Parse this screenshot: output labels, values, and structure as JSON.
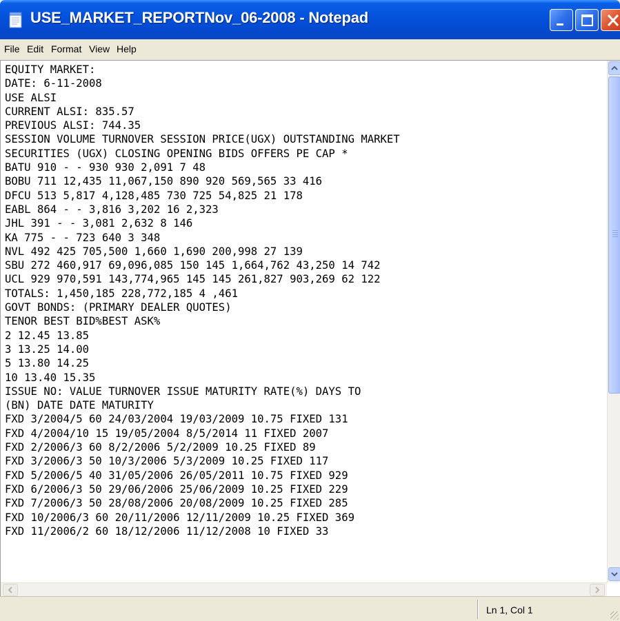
{
  "window": {
    "title": "USE_MARKET_REPORTNov_06-2008 - Notepad"
  },
  "menu": [
    "File",
    "Edit",
    "Format",
    "View",
    "Help"
  ],
  "document": {
    "lines": [
      "EQUITY MARKET:",
      "DATE: 6-11-2008",
      "USE ALSI",
      "CURRENT ALSI: 835.57",
      "PREVIOUS ALSI: 744.35",
      "SESSION VOLUME TURNOVER SESSION PRICE(UGX) OUTSTANDING MARKET",
      "SECURITIES (UGX) CLOSING OPENING BIDS OFFERS PE CAP *",
      "BATU 910 - - 930 930 2,091 7 48",
      "BOBU 711 12,435 11,067,150 890 920 569,565 33 416",
      "DFCU 513 5,817 4,128,485 730 725 54,825 21 178",
      "EABL 864 - - 3,816 3,202 16 2,323",
      "JHL 391 - - 3,081 2,632 8 146",
      "KA 775 - - 723 640 3 348",
      "NVL 492 425 705,500 1,660 1,690 200,998 27 139",
      "SBU 272 460,917 69,096,085 150 145 1,664,762 43,250 14 742",
      "UCL 929 970,591 143,774,965 145 145 261,827 903,269 62 122",
      "TOTALS: 1,450,185 228,772,185 4 ,461",
      "GOVT BONDS: (PRIMARY DEALER QUOTES)",
      "TENOR BEST BID%BEST ASK%",
      "2 12.45 13.85",
      "3 13.25 14.00",
      "5 13.80 14.25",
      "10 13.40 15.35",
      "ISSUE NO: VALUE TURNOVER ISSUE MATURITY RATE(%) DAYS TO",
      "(BN) DATE DATE MATURITY",
      "FXD 3/2004/5 60 24/03/2004 19/03/2009 10.75 FIXED 131",
      "FXD 4/2004/10 15 19/05/2004 8/5/2014 11 FIXED 2007",
      "FXD 2/2006/3 60 8/2/2006 5/2/2009 10.25 FIXED 89",
      "FXD 3/2006/3 50 10/3/2006 5/3/2009 10.25 FIXED 117",
      "FXD 5/2006/5 40 31/05/2006 26/05/2011 10.75 FIXED 929",
      "FXD 6/2006/3 50 29/06/2006 25/06/2009 10.25 FIXED 229",
      "FXD 7/2006/3 50 28/08/2006 20/08/2009 10.25 FIXED 285",
      "FXD 10/2006/3 60 20/11/2006 12/11/2009 10.25 FIXED 369",
      "FXD 11/2006/2 60 18/12/2006 11/12/2008 10 FIXED 33"
    ]
  },
  "status": {
    "position": "Ln 1, Col 1"
  },
  "colors": {
    "titlebar": "#0453dc",
    "close_button": "#d9522d",
    "chrome": "#ece9d8"
  },
  "icons": {
    "app": "notepad-icon",
    "minimize": "minimize-icon",
    "maximize": "maximize-icon",
    "close": "close-icon"
  }
}
